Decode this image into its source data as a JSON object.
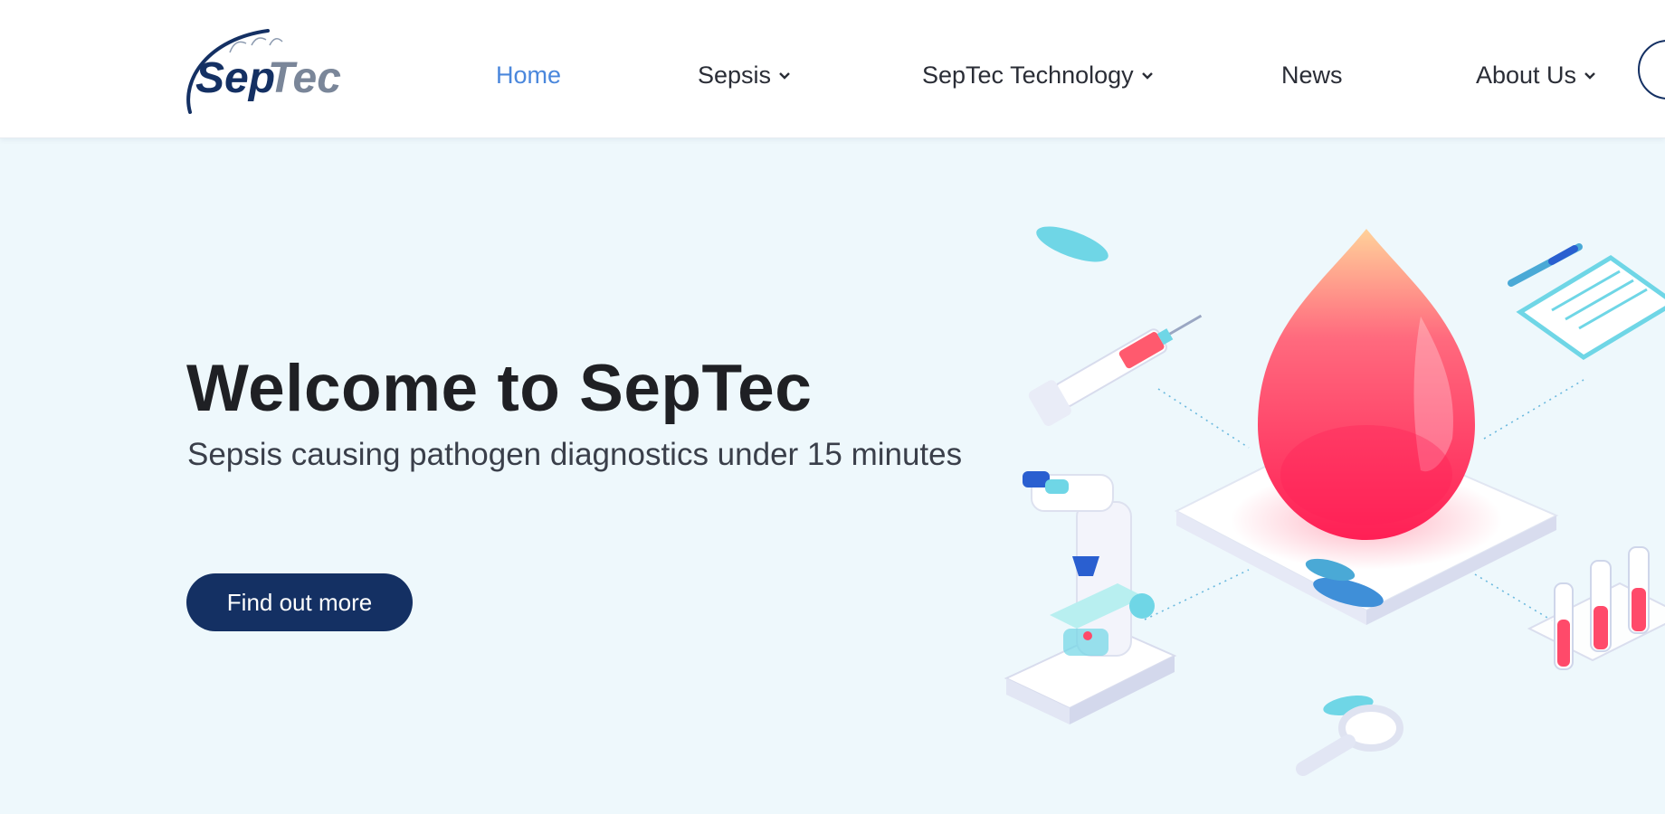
{
  "brand": {
    "logo_text": "SepTec"
  },
  "nav": {
    "items": [
      {
        "label": "Home",
        "active": true,
        "has_dropdown": false
      },
      {
        "label": "Sepsis",
        "active": false,
        "has_dropdown": true
      },
      {
        "label": "SepTec Technology",
        "active": false,
        "has_dropdown": true
      },
      {
        "label": "News",
        "active": false,
        "has_dropdown": false
      },
      {
        "label": "About Us",
        "active": false,
        "has_dropdown": true
      }
    ]
  },
  "hero": {
    "title": "Welcome to SepTec",
    "subtitle": "Sepsis causing pathogen diagnostics under 15 minutes",
    "cta_label": "Find out more"
  },
  "colors": {
    "nav_active": "#4a87dc",
    "cta_background": "#143063",
    "hero_background": "#eef8fc",
    "blood_drop": "#ff3b5c"
  },
  "icons": [
    "search-icon",
    "chevron-down-icon"
  ]
}
